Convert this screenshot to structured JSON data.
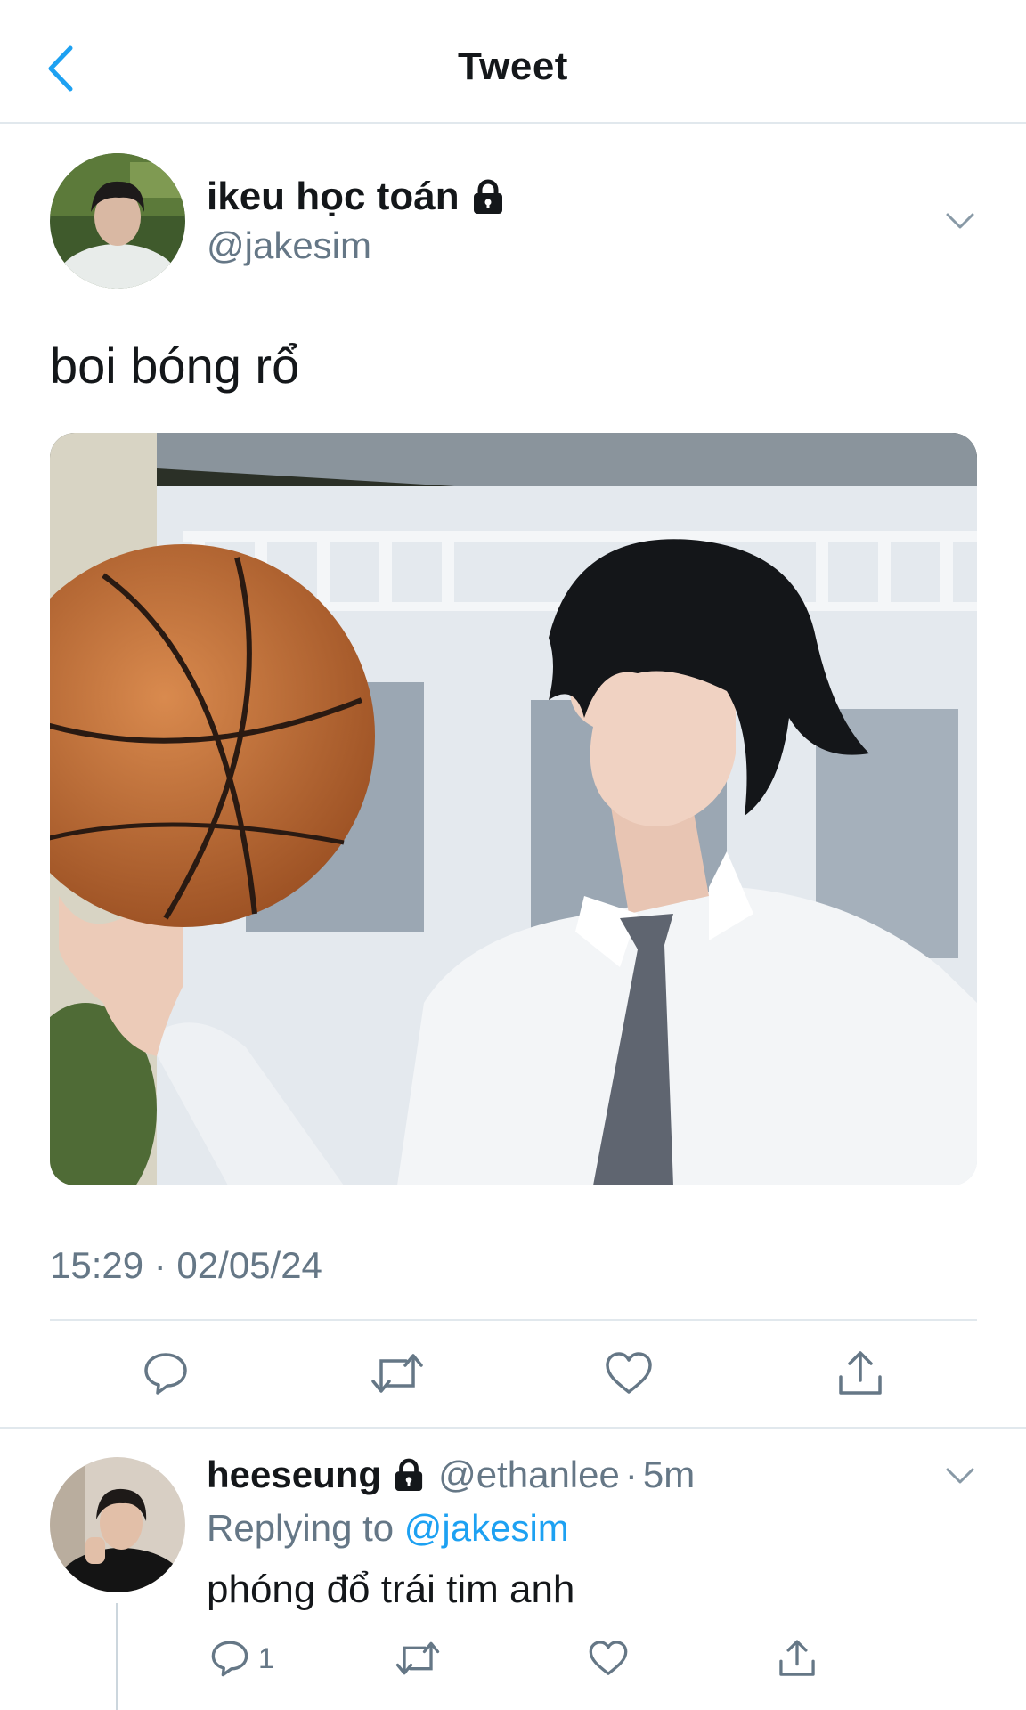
{
  "header": {
    "title": "Tweet",
    "back_icon": "chevron-left-icon"
  },
  "main_tweet": {
    "display_name": "ikeu học toán",
    "protected_icon": "lock-icon",
    "handle": "@jakesim",
    "text": "boi bóng rổ",
    "media_description_icon": "photo",
    "timestamp": "15:29 · 02/05/24",
    "actions": [
      "reply-icon",
      "retweet-icon",
      "like-icon",
      "share-icon"
    ]
  },
  "reply": {
    "display_name": "heeseung",
    "handle": "@ethanlee",
    "separator": "·",
    "time": "5m",
    "replying_prefix": "Replying to",
    "replying_handle": "@jakesim",
    "text": "phóng đổ trái tim anh",
    "reply_count": "1"
  },
  "colors": {
    "accent": "#1da1f2",
    "secondary_text": "#657786",
    "divider": "#e1e8ed"
  }
}
